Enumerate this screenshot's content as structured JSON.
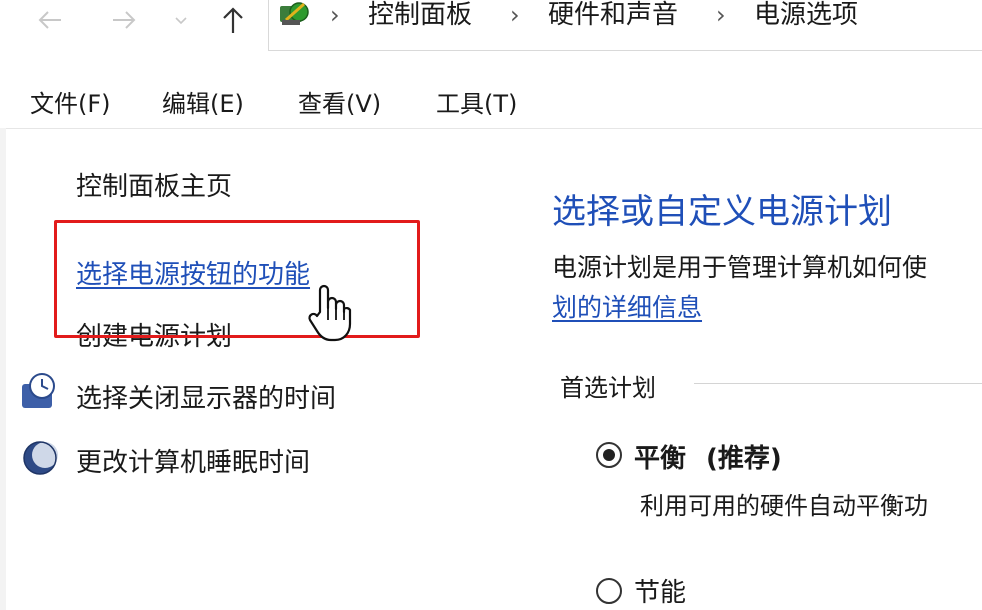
{
  "address_bar": {
    "breadcrumbs": [
      "控制面板",
      "硬件和声音",
      "电源选项"
    ]
  },
  "menu": {
    "items": [
      "文件(F)",
      "编辑(E)",
      "查看(V)",
      "工具(T)"
    ]
  },
  "sidebar": {
    "home": "控制面板主页",
    "links": [
      {
        "label": "选择电源按钮的功能"
      },
      {
        "label": "创建电源计划"
      },
      {
        "label": "选择关闭显示器的时间",
        "icon": "monitor-clock-icon"
      },
      {
        "label": "更改计算机睡眠时间",
        "icon": "moon-icon"
      }
    ]
  },
  "main": {
    "title": "选择或自定义电源计划",
    "description": "电源计划是用于管理计算机如何使",
    "more_link": "划的详细信息",
    "section_label": "首选计划",
    "plans": [
      {
        "name": "平衡",
        "tag": "(推荐)",
        "selected": true,
        "description": "利用可用的硬件自动平衡功"
      },
      {
        "name": "节能",
        "selected": false
      }
    ]
  },
  "colors": {
    "link": "#1f4fb8",
    "highlight_box": "#e21b1b"
  }
}
